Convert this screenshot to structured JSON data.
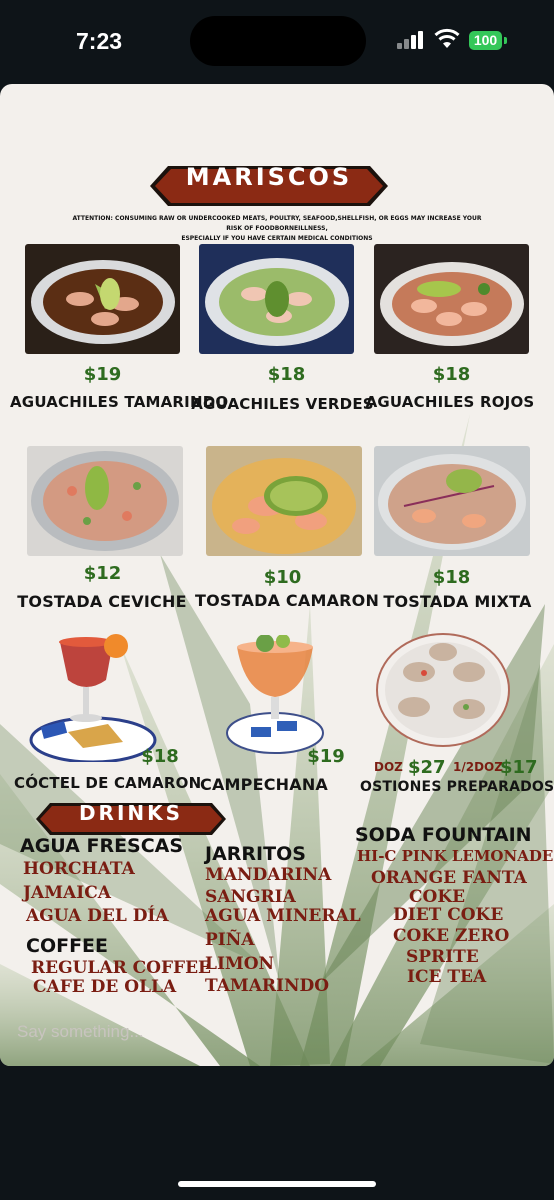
{
  "status_bar": {
    "time": "7:23",
    "battery": "100"
  },
  "menu": {
    "title": "MARISCOS",
    "warning_line1": "ATTENTION: CONSUMING RAW OR UNDERCOOKED MEATS, POULTRY, SEAFOOD,SHELLFISH, OR EGGS MAY INCREASE YOUR RISK OF FOODBORNEILLNESS,",
    "warning_line2": "ESPECIALLY IF YOU HAVE CERTAIN MEDICAL CONDITIONS",
    "items": [
      {
        "name": "AGUACHILES TAMARINDO",
        "price": "$19"
      },
      {
        "name": "AGUACHILES VERDES",
        "price": "$18"
      },
      {
        "name": "AGUACHILES ROJOS",
        "price": "$18"
      },
      {
        "name": "TOSTADA CEVICHE",
        "price": "$12"
      },
      {
        "name": "TOSTADA CAMARON",
        "price": "$10"
      },
      {
        "name": "TOSTADA MIXTA",
        "price": "$18"
      },
      {
        "name": "CÓCTEL DE CAMARON",
        "price": "$18"
      },
      {
        "name": "CAMPECHANA",
        "price": "$19"
      }
    ],
    "ostiones": {
      "name": "OSTIONES PREPARADOS",
      "doz_label": "DOZ",
      "doz_price": "$27",
      "half_label": "1/2DOZ",
      "half_price": "$17"
    },
    "drinks_title": "DRINKS",
    "agua_frescas": {
      "heading": "AGUA FRESCAS",
      "items": [
        "HORCHATA",
        "JAMAICA",
        "AGUA DEL DÍA"
      ]
    },
    "coffee": {
      "heading": "COFFEE",
      "items": [
        "REGULAR COFFEE",
        "CAFE DE OLLA"
      ]
    },
    "jarritos": {
      "heading": "JARRITOS",
      "items": [
        "MANDARINA",
        "SANGRIA",
        "AGUA MINERAL",
        "PIÑA",
        "LIMON",
        "TAMARINDO"
      ]
    },
    "soda_fountain": {
      "heading": "SODA FOUNTAIN",
      "items": [
        "HI-C PINK LEMONADE",
        "ORANGE FANTA",
        "COKE",
        "DIET COKE",
        "COKE ZERO",
        "SPRITE",
        "ICE TEA"
      ]
    }
  },
  "chat": {
    "placeholder": "Say something..."
  },
  "colors": {
    "banner": "#8b2a14",
    "price_green": "#2e6b1f",
    "drink_red": "#7a1d12",
    "battery": "#34c759"
  }
}
